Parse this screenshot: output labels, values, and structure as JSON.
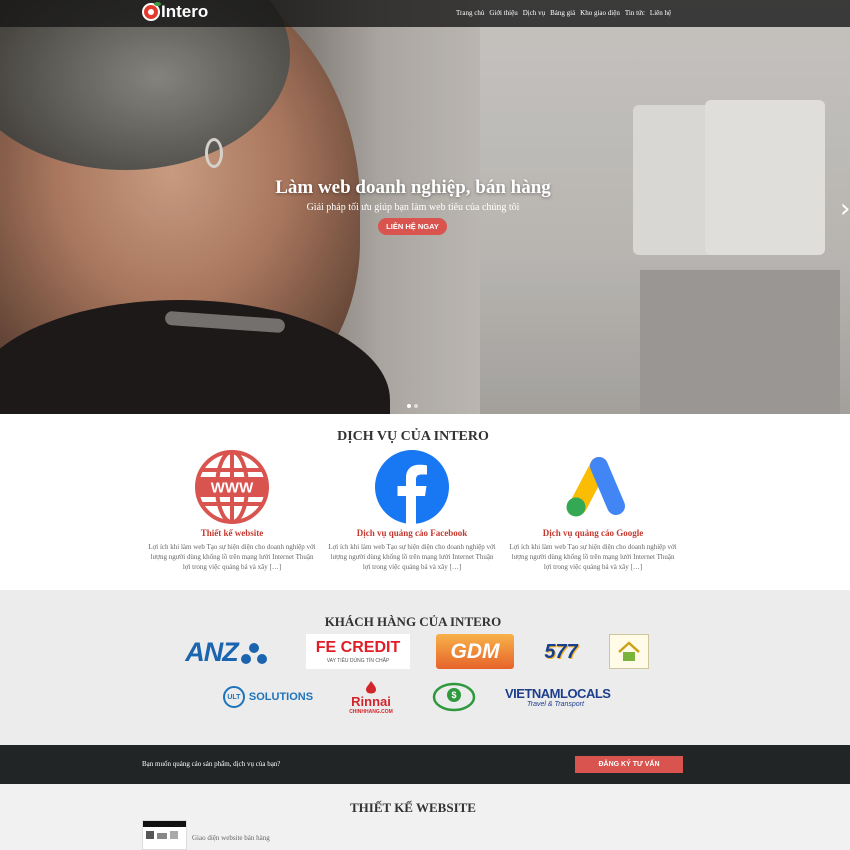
{
  "brand": {
    "name": "Intero",
    "accent": "#d9534f"
  },
  "nav": {
    "items": [
      "Trang chủ",
      "Giới thiệu",
      "Dịch vụ",
      "Bảng giá",
      "Kho giao diện",
      "Tin tức",
      "Liên hệ"
    ]
  },
  "hero": {
    "title": "Làm web doanh nghiệp, bán hàng",
    "subtitle": "Giải pháp tối ưu giúp bạn làm web tiêu của chúng tôi",
    "button": "LIÊN HỆ NGAY",
    "next_icon": "›",
    "slide_count": 2,
    "active_slide": 1
  },
  "services": {
    "title": "DỊCH VỤ CỦA INTERO",
    "items": [
      {
        "icon": "www-globe-icon",
        "title": "Thiết kế website",
        "desc": "Lợi ích khi làm web Tạo sự hiện diện cho doanh nghiệp với lượng người dùng khổng lồ trên mạng lưới Internet Thuận lợi trong việc quảng bá và xây […]"
      },
      {
        "icon": "facebook-icon",
        "title": "Dịch vụ quảng cáo Facebook",
        "desc": "Lợi ích khi làm web Tạo sự hiện diện cho doanh nghiệp với lượng người dùng khổng lồ trên mạng lưới Internet Thuận lợi trong việc quảng bá và xây […]"
      },
      {
        "icon": "google-ads-icon",
        "title": "Dịch vụ quảng cáo Google",
        "desc": "Lợi ích khi làm web Tạo sự hiện diện cho doanh nghiệp với lượng người dùng khổng lồ trên mạng lưới Internet Thuận lợi trong việc quảng bá và xây […]"
      }
    ]
  },
  "clients": {
    "title": "KHÁCH HÀNG CỦA INTERO",
    "logos": {
      "anz": "ANZ",
      "fecredit": "FE CREDIT",
      "fecredit_tag": "VAY TIÊU DÙNG TÍN CHẤP",
      "gdm": "GDM",
      "n577": "577",
      "house": "house-logo",
      "ult": "ULT",
      "solutions": "SOLUTIONS",
      "rinnai": "Rinnai",
      "rinnai_sub": "CHINHHANG.COM",
      "green": "green-circle-logo",
      "vietnam": "VIETNAMLOCALS",
      "vietnam_sub": "Travel & Transport"
    }
  },
  "cta": {
    "text": "Bạn muốn quảng cáo sản phẩm, dịch vụ của bạn?",
    "button": "ĐĂNG KÝ TƯ VẤN"
  },
  "web_design": {
    "title": "THIẾT KẾ WEBSITE",
    "items": [
      "Giao diện website bán hàng"
    ]
  }
}
